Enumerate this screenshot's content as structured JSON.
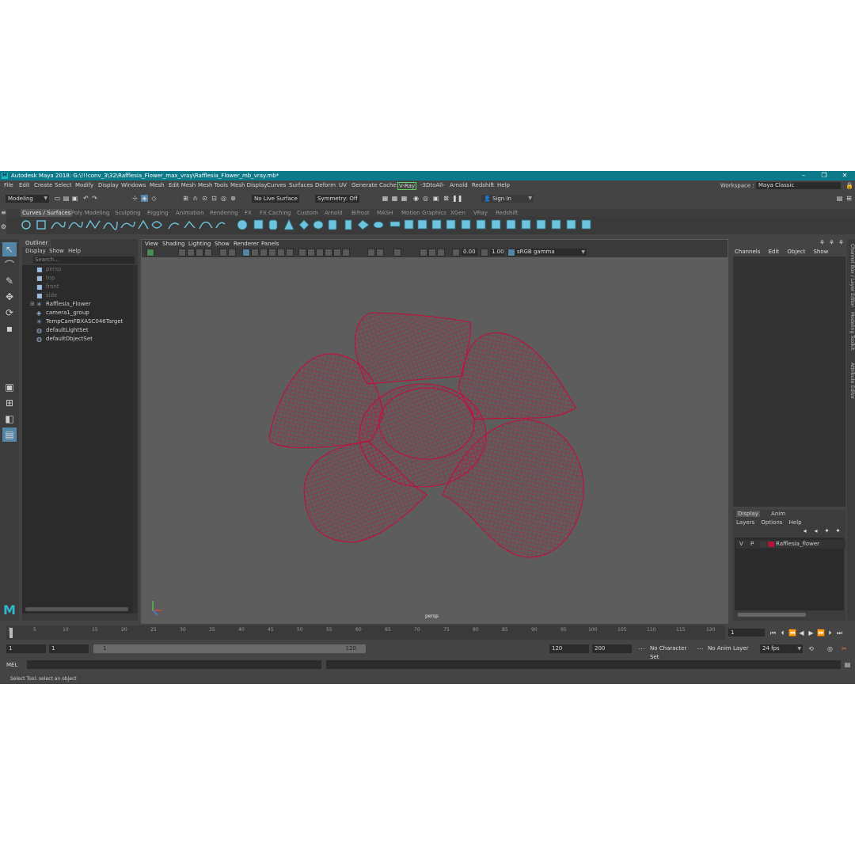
{
  "window": {
    "title": "Autodesk Maya 2018: G:\\!!!conv_3\\32\\Rafflesia_Flower_max_vray\\Rafflesia_Flower_mb_vray.mb*",
    "app_icon": "M",
    "controls": [
      "–",
      "❐",
      "✕"
    ]
  },
  "menubar": {
    "items": [
      "File",
      "Edit",
      "Create",
      "Select",
      "Modify",
      "Display",
      "Windows",
      "Mesh",
      "Edit Mesh",
      "Mesh Tools",
      "Mesh Display",
      "Curves",
      "Surfaces",
      "Deform",
      "UV",
      "Generate",
      "Cache",
      "V-Ray",
      "-3DtoAll-",
      "Arnold",
      "Redshift",
      "Help"
    ],
    "workspace_label": "Workspace :",
    "workspace_value": "Maya Classic"
  },
  "statusline": {
    "mode": "Modeling",
    "live_surface": "No Live Surface",
    "symmetry": "Symmetry: Off",
    "sign_in": "Sign In"
  },
  "shelf": {
    "tabs": [
      "Curves / Surfaces",
      "Poly Modeling",
      "Sculpting",
      "Rigging",
      "Animation",
      "Rendering",
      "FX",
      "FX Caching",
      "Custom",
      "Arnold",
      "Bifrost",
      "MASH",
      "Motion Graphics",
      "XGen",
      "VRay",
      "Redshift"
    ],
    "active_tab": "Curves / Surfaces"
  },
  "outliner": {
    "title": "Outliner",
    "menu": [
      "Display",
      "Show",
      "Help"
    ],
    "search_placeholder": "Search...",
    "items": [
      {
        "label": "persp",
        "icon": "camera-icon",
        "dim": true
      },
      {
        "label": "top",
        "icon": "camera-icon",
        "dim": true
      },
      {
        "label": "front",
        "icon": "camera-icon",
        "dim": true
      },
      {
        "label": "side",
        "icon": "camera-icon",
        "dim": true
      },
      {
        "label": "Rafflesia_Flower",
        "icon": "transform-icon",
        "dim": false
      },
      {
        "label": "camera1_group",
        "icon": "group-icon",
        "dim": false
      },
      {
        "label": "TempCamFBXASC046Target",
        "icon": "transform-icon",
        "dim": false
      },
      {
        "label": "defaultLightSet",
        "icon": "set-icon",
        "dim": false
      },
      {
        "label": "defaultObjectSet",
        "icon": "set-icon",
        "dim": false
      }
    ]
  },
  "viewport": {
    "menu": [
      "View",
      "Shading",
      "Lighting",
      "Show",
      "Renderer",
      "Panels"
    ],
    "exposure": "0.00",
    "gamma": "1.00",
    "color_space": "sRGB gamma",
    "camera_label": "persp",
    "wire_color": "#c0103c"
  },
  "channelbox": {
    "menu": [
      "Channels",
      "Edit",
      "Object",
      "Show"
    ],
    "layer_tabs": [
      "Display",
      "Anim"
    ],
    "layer_menu": [
      "Layers",
      "Options",
      "Help"
    ],
    "layer": {
      "v": "V",
      "p": "P",
      "name": "Rafflesia_flower",
      "color": "#b3143c"
    }
  },
  "side_tabs": [
    "Channel Box / Layer Editor",
    "Modeling Toolkit",
    "Attribute Editor"
  ],
  "timeslider": {
    "ticks": [
      "1",
      "5",
      "10",
      "15",
      "20",
      "25",
      "30",
      "35",
      "40",
      "45",
      "50",
      "55",
      "60",
      "65",
      "70",
      "75",
      "80",
      "85",
      "90",
      "95",
      "100",
      "105",
      "110",
      "115",
      "120"
    ],
    "current_frame": "1"
  },
  "range": {
    "start": "1",
    "inner_start": "1",
    "slider_start": "1",
    "slider_end": "120",
    "end": "120",
    "anim_end": "200",
    "character_set": "No Character Set",
    "anim_layer": "No Anim Layer",
    "fps": "24 fps"
  },
  "cmdline": {
    "label": "MEL"
  },
  "help_text": "Select Tool: select an object"
}
